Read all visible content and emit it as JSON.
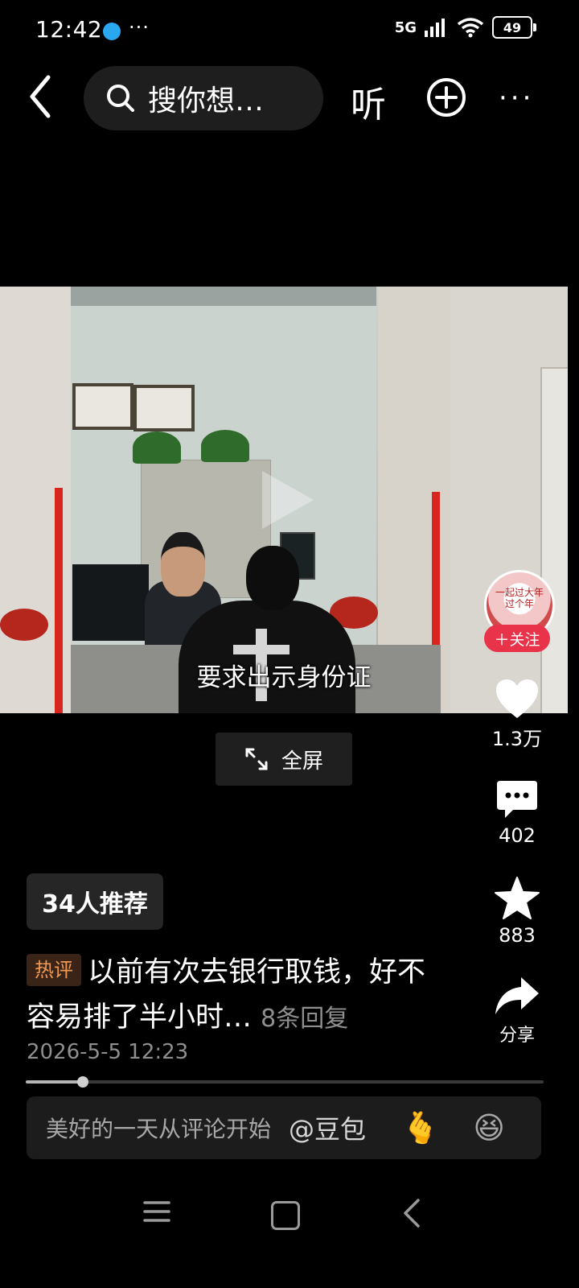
{
  "status_bar": {
    "time": "12:42",
    "more": "···",
    "network": "5G",
    "battery": "49"
  },
  "top_bar": {
    "search_placeholder": "搜你想…",
    "listen_label": "听",
    "more_label": "···"
  },
  "video": {
    "subtitle": "要求出示身份证"
  },
  "fullscreen": {
    "label": "全屏"
  },
  "author": {
    "follow_label": "＋关注",
    "avatar_text_line1": "一起过大年",
    "avatar_text_line2": "过个年"
  },
  "actions": {
    "likes": "1.3万",
    "comments": "402",
    "favorites": "883",
    "share_label": "分享"
  },
  "recommend": {
    "label": "34人推荐"
  },
  "hot_comment": {
    "tag": "热评",
    "text": "以前有次去银行取钱，好不容易排了半小时…",
    "reply_count": "8条回复",
    "time": "2026-5-5 12:23"
  },
  "progress": {
    "fraction": 0.11
  },
  "comment_input": {
    "placeholder": "美好的一天从评论开始",
    "mention": "@豆包"
  },
  "colors": {
    "accent_follow": "#e8334a",
    "hot_tag": "#f09a55"
  }
}
